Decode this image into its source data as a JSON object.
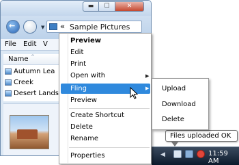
{
  "window": {
    "controls": {
      "minimize": "▬",
      "maximize": "☐",
      "close": "✕"
    },
    "address": {
      "separator": "«",
      "path": "Sample Pictures"
    },
    "menubar": [
      "File",
      "Edit",
      "V"
    ],
    "list_header": {
      "name_column": "Name",
      "sort_indicator": "^"
    },
    "files": [
      "Autumn Lea",
      "Creek",
      "Desert Lands"
    ]
  },
  "context_menu": {
    "items": [
      {
        "label": "Preview",
        "bold": true
      },
      {
        "label": "Edit"
      },
      {
        "label": "Print"
      },
      {
        "label": "Open with",
        "has_submenu": true
      },
      {
        "label": "Fling",
        "has_submenu": true,
        "highlighted": true
      },
      {
        "label": "Preview"
      },
      {
        "label": "Create Shortcut"
      },
      {
        "label": "Delete"
      },
      {
        "label": "Rename"
      },
      {
        "label": "Properties"
      }
    ],
    "submenu_arrow": "▶"
  },
  "fling_submenu": [
    "Upload",
    "Download",
    "Delete"
  ],
  "notification": {
    "text": "Files uploaded OK"
  },
  "taskbar": {
    "tray_arrow": "◀",
    "clock": "11:59 AM"
  },
  "colors": {
    "highlight": "#2f89dd",
    "taskbar": "#0c1a2c"
  }
}
